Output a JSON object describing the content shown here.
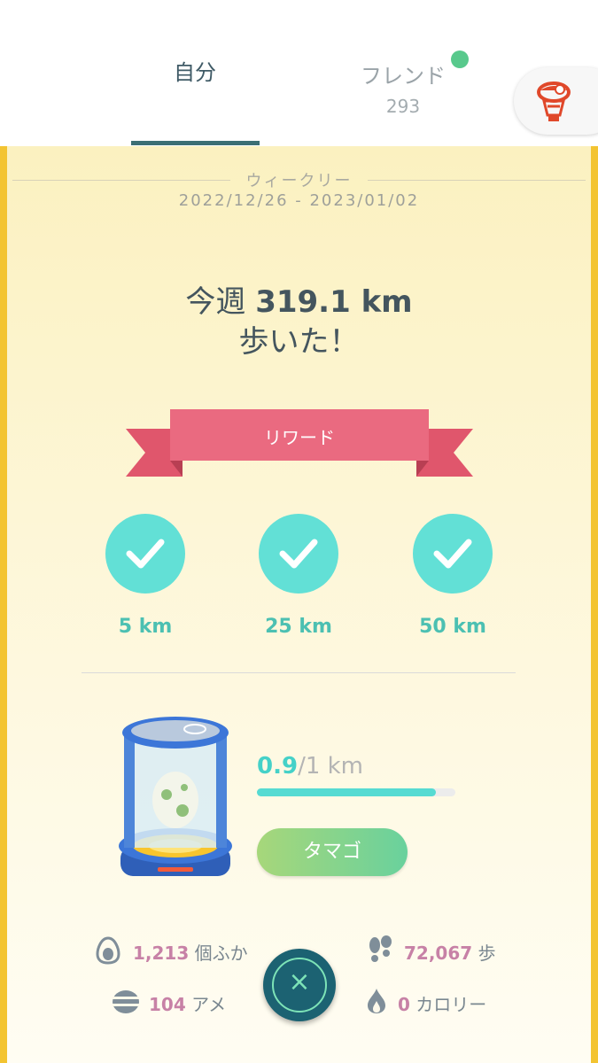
{
  "tabs": {
    "self_label": "自分",
    "friend_label": "フレンド",
    "friend_count": "293"
  },
  "weekly": {
    "label": "ウィークリー",
    "date_range": "2022/12/26 - 2023/01/02",
    "prefix": "今週",
    "distance": "319.1 km",
    "walked": "歩いた！"
  },
  "rewards": {
    "title": "リワード",
    "items": [
      {
        "label": "5 km"
      },
      {
        "label": "25 km"
      },
      {
        "label": "50 km"
      }
    ]
  },
  "egg": {
    "current": "0.9",
    "total": "/1 km",
    "progress_fraction": 0.9,
    "button_label": "タマゴ"
  },
  "stats": {
    "hatched_value": "1,213",
    "hatched_unit": "個ふか",
    "steps_value": "72,067",
    "steps_unit": "歩",
    "candy_value": "104",
    "candy_unit": "アメ",
    "calories_value": "0",
    "calories_unit": "カロリー"
  },
  "close_glyph": "×",
  "colors": {
    "accent_teal": "#62e0d6",
    "ribbon_pink": "#e86a80",
    "border_yellow": "#f3c431",
    "stat_pink": "#c781a6"
  },
  "icons": [
    "profile-icon",
    "check-icon",
    "egg-icon",
    "footprints-icon",
    "candy-icon",
    "flame-icon",
    "close-icon"
  ]
}
